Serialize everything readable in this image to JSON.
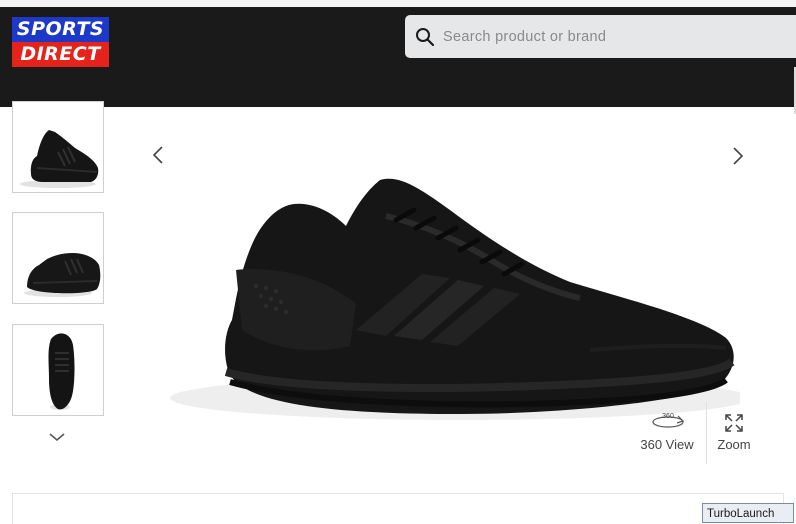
{
  "header": {
    "logo_line1": "SPORTS",
    "logo_line2": "DIRECT",
    "search_placeholder": "Search product or brand",
    "search_value": ""
  },
  "gallery": {
    "thumbnails": [
      "shoe-side-view",
      "shoe-rear-view",
      "shoe-top-view"
    ],
    "prev_icon": "chevron-left-icon",
    "next_icon": "chevron-right-icon",
    "thumbs_down_icon": "chevron-down-icon"
  },
  "tools": {
    "view360_badge": "360",
    "view360_label": "360 View",
    "zoom_label": "Zoom"
  },
  "taskbar": {
    "turbo_label": "TurboLaunch"
  },
  "colors": {
    "header_bg": "#1a1a1a",
    "logo_blue": "#1d39c9",
    "logo_red": "#e5231b",
    "search_bg": "#e6e7e9"
  }
}
